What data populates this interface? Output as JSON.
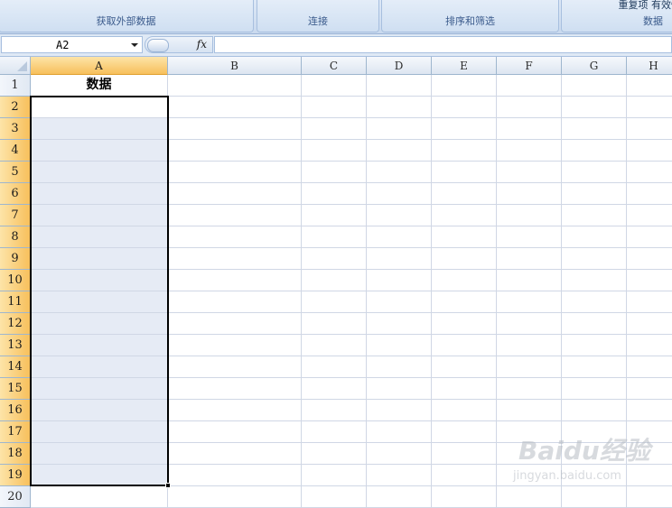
{
  "ribbon": {
    "groups": [
      {
        "label": "获取外部数据"
      },
      {
        "label": "连接"
      },
      {
        "label": "排序和筛选"
      },
      {
        "label": "数据",
        "top_text": "重复项 有效性"
      }
    ]
  },
  "formula_bar": {
    "name_box": "A2",
    "fx_label": "fx",
    "formula_value": ""
  },
  "grid": {
    "columns": [
      "A",
      "B",
      "C",
      "D",
      "E",
      "F",
      "G",
      "H"
    ],
    "rows": [
      "1",
      "2",
      "3",
      "4",
      "5",
      "6",
      "7",
      "8",
      "9",
      "10",
      "11",
      "12",
      "13",
      "14",
      "15",
      "16",
      "17",
      "18",
      "19",
      "20"
    ],
    "selected_column": "A",
    "selected_rows": "2-19",
    "cells": {
      "A1": "数据"
    }
  },
  "watermark": {
    "brand": "Baidu经验",
    "url": "jingyan.baidu.com"
  },
  "colors": {
    "selection_header": "#f7c05c",
    "range_fill": "#e6ebf5",
    "gridline": "#d0d7e5"
  }
}
